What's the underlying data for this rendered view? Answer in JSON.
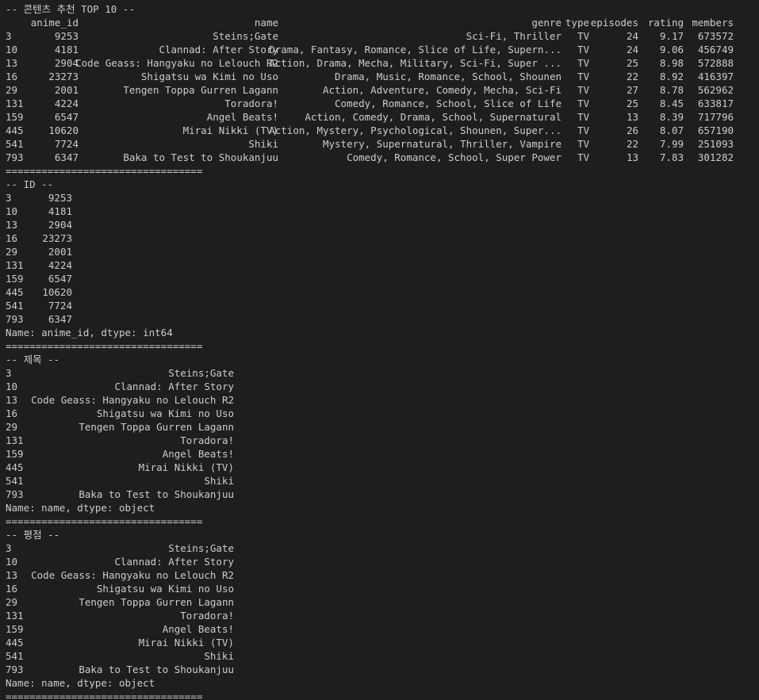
{
  "section_recommend": {
    "header": "-- 콘텐츠 추천 TOP 10 --",
    "columns": [
      "anime_id",
      "name",
      "genre",
      "type",
      "episodes",
      "rating",
      "members"
    ],
    "rows": [
      {
        "idx": "3",
        "anime_id": "9253",
        "name": "Steins;Gate",
        "genre": "Sci-Fi, Thriller",
        "type": "TV",
        "episodes": "24",
        "rating": "9.17",
        "members": "673572"
      },
      {
        "idx": "10",
        "anime_id": "4181",
        "name": "Clannad: After Story",
        "genre": "Drama, Fantasy, Romance, Slice of Life, Supern...",
        "type": "TV",
        "episodes": "24",
        "rating": "9.06",
        "members": "456749"
      },
      {
        "idx": "13",
        "anime_id": "2904",
        "name": "Code Geass: Hangyaku no Lelouch R2",
        "genre": "Action, Drama, Mecha, Military, Sci-Fi, Super ...",
        "type": "TV",
        "episodes": "25",
        "rating": "8.98",
        "members": "572888"
      },
      {
        "idx": "16",
        "anime_id": "23273",
        "name": "Shigatsu wa Kimi no Uso",
        "genre": "Drama, Music, Romance, School, Shounen",
        "type": "TV",
        "episodes": "22",
        "rating": "8.92",
        "members": "416397"
      },
      {
        "idx": "29",
        "anime_id": "2001",
        "name": "Tengen Toppa Gurren Lagann",
        "genre": "Action, Adventure, Comedy, Mecha, Sci-Fi",
        "type": "TV",
        "episodes": "27",
        "rating": "8.78",
        "members": "562962"
      },
      {
        "idx": "131",
        "anime_id": "4224",
        "name": "Toradora!",
        "genre": "Comedy, Romance, School, Slice of Life",
        "type": "TV",
        "episodes": "25",
        "rating": "8.45",
        "members": "633817"
      },
      {
        "idx": "159",
        "anime_id": "6547",
        "name": "Angel Beats!",
        "genre": "Action, Comedy, Drama, School, Supernatural",
        "type": "TV",
        "episodes": "13",
        "rating": "8.39",
        "members": "717796"
      },
      {
        "idx": "445",
        "anime_id": "10620",
        "name": "Mirai Nikki (TV)",
        "genre": "Action, Mystery, Psychological, Shounen, Super...",
        "type": "TV",
        "episodes": "26",
        "rating": "8.07",
        "members": "657190"
      },
      {
        "idx": "541",
        "anime_id": "7724",
        "name": "Shiki",
        "genre": "Mystery, Supernatural, Thriller, Vampire",
        "type": "TV",
        "episodes": "22",
        "rating": "7.99",
        "members": "251093"
      },
      {
        "idx": "793",
        "anime_id": "6347",
        "name": "Baka to Test to Shoukanjuu",
        "genre": "Comedy, Romance, School, Super Power",
        "type": "TV",
        "episodes": "13",
        "rating": "7.83",
        "members": "301282"
      }
    ]
  },
  "separator": "=================================",
  "section_id": {
    "header": "-- ID --",
    "rows": [
      {
        "idx": "3",
        "value": "9253"
      },
      {
        "idx": "10",
        "value": "4181"
      },
      {
        "idx": "13",
        "value": "2904"
      },
      {
        "idx": "16",
        "value": "23273"
      },
      {
        "idx": "29",
        "value": "2001"
      },
      {
        "idx": "131",
        "value": "4224"
      },
      {
        "idx": "159",
        "value": "6547"
      },
      {
        "idx": "445",
        "value": "10620"
      },
      {
        "idx": "541",
        "value": "7724"
      },
      {
        "idx": "793",
        "value": "6347"
      }
    ],
    "footer": "Name: anime_id, dtype: int64"
  },
  "section_title": {
    "header": "-- 제목 --",
    "rows": [
      {
        "idx": "3",
        "value": "Steins;Gate"
      },
      {
        "idx": "10",
        "value": "Clannad: After Story"
      },
      {
        "idx": "13",
        "value": "Code Geass: Hangyaku no Lelouch R2"
      },
      {
        "idx": "16",
        "value": "Shigatsu wa Kimi no Uso"
      },
      {
        "idx": "29",
        "value": "Tengen Toppa Gurren Lagann"
      },
      {
        "idx": "131",
        "value": "Toradora!"
      },
      {
        "idx": "159",
        "value": "Angel Beats!"
      },
      {
        "idx": "445",
        "value": "Mirai Nikki (TV)"
      },
      {
        "idx": "541",
        "value": "Shiki"
      },
      {
        "idx": "793",
        "value": "Baka to Test to Shoukanjuu"
      }
    ],
    "footer": "Name: name, dtype: object"
  },
  "section_rating": {
    "header": "-- 평점 --",
    "rows": [
      {
        "idx": "3",
        "value": "Steins;Gate"
      },
      {
        "idx": "10",
        "value": "Clannad: After Story"
      },
      {
        "idx": "13",
        "value": "Code Geass: Hangyaku no Lelouch R2"
      },
      {
        "idx": "16",
        "value": "Shigatsu wa Kimi no Uso"
      },
      {
        "idx": "29",
        "value": "Tengen Toppa Gurren Lagann"
      },
      {
        "idx": "131",
        "value": "Toradora!"
      },
      {
        "idx": "159",
        "value": "Angel Beats!"
      },
      {
        "idx": "445",
        "value": "Mirai Nikki (TV)"
      },
      {
        "idx": "541",
        "value": "Shiki"
      },
      {
        "idx": "793",
        "value": "Baka to Test to Shoukanjuu"
      }
    ],
    "footer": "Name: name, dtype: object"
  }
}
